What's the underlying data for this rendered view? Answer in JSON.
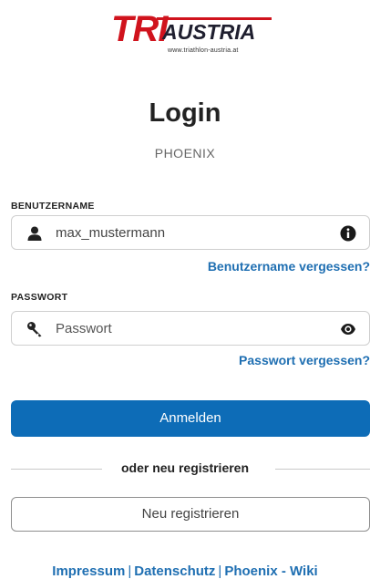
{
  "logo": {
    "tri": "TRI",
    "austria": "AUSTRIA",
    "url": "www.triathlon-austria.at"
  },
  "header": {
    "title": "Login",
    "subtitle": "PHOENIX"
  },
  "username": {
    "label": "BENUTZERNAME",
    "value": "max_mustermann",
    "lead_icon": "user-icon",
    "trail_icon": "info-icon",
    "forgot_link": "Benutzername vergessen?"
  },
  "password": {
    "label": "PASSWORT",
    "placeholder": "Passwort",
    "lead_icon": "key-icon",
    "trail_icon": "eye-icon",
    "forgot_link": "Passwort vergessen?"
  },
  "login_button": "Anmelden",
  "divider_text": "oder neu registrieren",
  "register_button": "Neu registrieren",
  "footer": {
    "links": [
      "Impressum",
      "Datenschutz",
      "Phoenix - Wiki"
    ],
    "separator": "|"
  },
  "colors": {
    "primary": "#0d6cb7",
    "link": "#1f6fb2",
    "brand_red": "#d0131d"
  }
}
